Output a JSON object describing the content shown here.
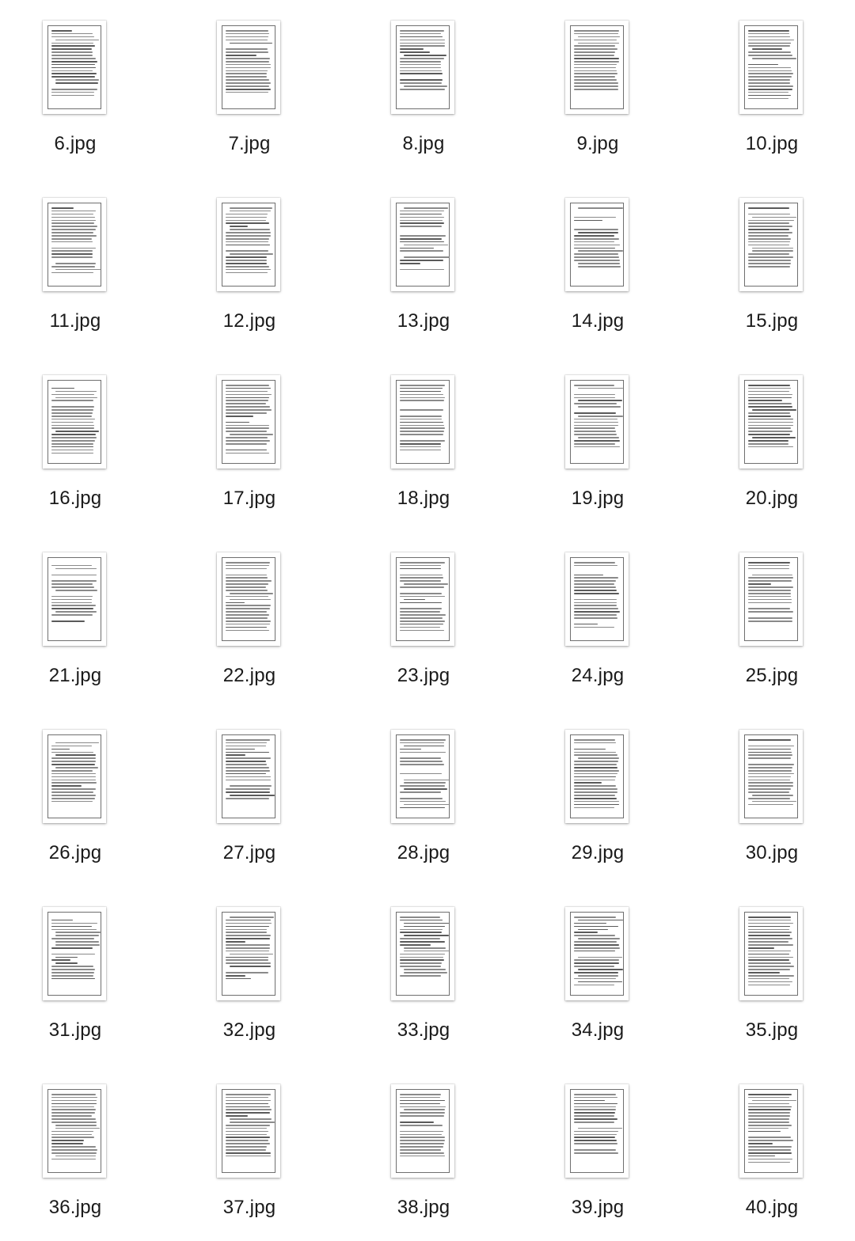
{
  "files": [
    {
      "name": "6.jpg",
      "icon": "document-thumbnail-icon"
    },
    {
      "name": "7.jpg",
      "icon": "document-thumbnail-icon"
    },
    {
      "name": "8.jpg",
      "icon": "document-thumbnail-icon"
    },
    {
      "name": "9.jpg",
      "icon": "document-thumbnail-icon"
    },
    {
      "name": "10.jpg",
      "icon": "document-thumbnail-icon"
    },
    {
      "name": "11.jpg",
      "icon": "document-thumbnail-icon"
    },
    {
      "name": "12.jpg",
      "icon": "document-thumbnail-icon"
    },
    {
      "name": "13.jpg",
      "icon": "document-thumbnail-icon"
    },
    {
      "name": "14.jpg",
      "icon": "document-thumbnail-icon"
    },
    {
      "name": "15.jpg",
      "icon": "document-thumbnail-icon"
    },
    {
      "name": "16.jpg",
      "icon": "document-thumbnail-icon"
    },
    {
      "name": "17.jpg",
      "icon": "document-thumbnail-icon"
    },
    {
      "name": "18.jpg",
      "icon": "document-thumbnail-icon"
    },
    {
      "name": "19.jpg",
      "icon": "document-thumbnail-icon"
    },
    {
      "name": "20.jpg",
      "icon": "document-thumbnail-icon"
    },
    {
      "name": "21.jpg",
      "icon": "document-thumbnail-icon"
    },
    {
      "name": "22.jpg",
      "icon": "document-thumbnail-icon"
    },
    {
      "name": "23.jpg",
      "icon": "document-thumbnail-icon"
    },
    {
      "name": "24.jpg",
      "icon": "document-thumbnail-icon"
    },
    {
      "name": "25.jpg",
      "icon": "document-thumbnail-icon"
    },
    {
      "name": "26.jpg",
      "icon": "document-thumbnail-icon"
    },
    {
      "name": "27.jpg",
      "icon": "document-thumbnail-icon"
    },
    {
      "name": "28.jpg",
      "icon": "document-thumbnail-icon"
    },
    {
      "name": "29.jpg",
      "icon": "document-thumbnail-icon"
    },
    {
      "name": "30.jpg",
      "icon": "document-thumbnail-icon"
    },
    {
      "name": "31.jpg",
      "icon": "document-thumbnail-icon"
    },
    {
      "name": "32.jpg",
      "icon": "document-thumbnail-icon"
    },
    {
      "name": "33.jpg",
      "icon": "document-thumbnail-icon"
    },
    {
      "name": "34.jpg",
      "icon": "document-thumbnail-icon"
    },
    {
      "name": "35.jpg",
      "icon": "document-thumbnail-icon"
    },
    {
      "name": "36.jpg",
      "icon": "document-thumbnail-icon"
    },
    {
      "name": "37.jpg",
      "icon": "document-thumbnail-icon"
    },
    {
      "name": "38.jpg",
      "icon": "document-thumbnail-icon"
    },
    {
      "name": "39.jpg",
      "icon": "document-thumbnail-icon"
    },
    {
      "name": "40.jpg",
      "icon": "document-thumbnail-icon"
    }
  ],
  "colors": {
    "background": "#ffffff",
    "label_text": "#1a1a1a",
    "thumbnail_border": "#6f6f6f",
    "thumbnail_text": "#8a8a8a"
  }
}
